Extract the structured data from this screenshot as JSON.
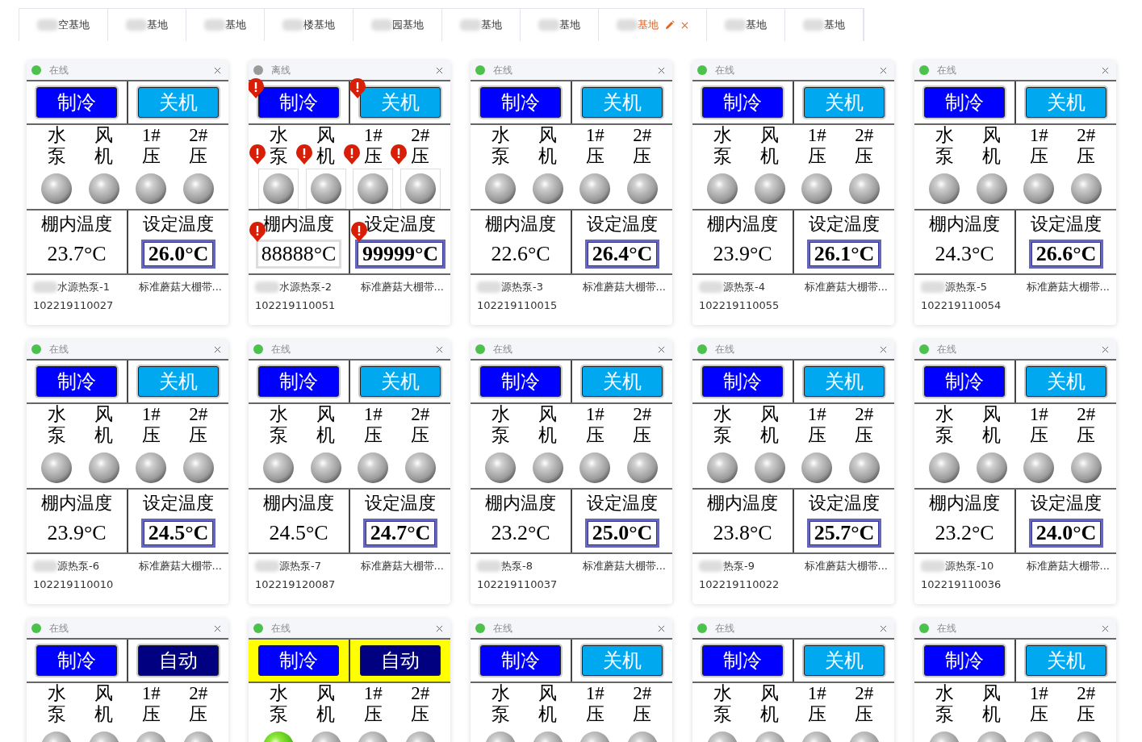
{
  "tabs": [
    {
      "label": "空基地",
      "selected": false
    },
    {
      "label": "基地",
      "selected": false
    },
    {
      "label": "基地",
      "selected": false
    },
    {
      "label": "楼基地",
      "selected": false
    },
    {
      "label": "园基地",
      "selected": false
    },
    {
      "label": "基地",
      "selected": false
    },
    {
      "label": "基地",
      "selected": false
    },
    {
      "label": "基地",
      "selected": true
    },
    {
      "label": "基地",
      "selected": false
    },
    {
      "label": "基地",
      "selected": false
    }
  ],
  "cards": [
    {
      "status": "在线",
      "online": true,
      "alarm": false,
      "highlight": false,
      "mode": "制冷",
      "power": {
        "label": "关机",
        "kind": "off"
      },
      "lamps": [
        {
          "top": "水",
          "bottom": "泵",
          "on": false
        },
        {
          "top": "风",
          "bottom": "机",
          "on": false
        },
        {
          "top": "1#",
          "bottom": "压",
          "on": false
        },
        {
          "top": "2#",
          "bottom": "压",
          "on": false
        }
      ],
      "inside_label": "棚内温度",
      "inside_temp": "23.7°C",
      "set_label": "设定温度",
      "set_temp": "26.0°C",
      "name": "水源热泵-1",
      "desc": "标准蘑菇大棚带...",
      "serial": "102219110027"
    },
    {
      "status": "离线",
      "online": false,
      "alarm": true,
      "highlight": false,
      "mode": "制冷",
      "power": {
        "label": "关机",
        "kind": "off"
      },
      "lamps": [
        {
          "top": "水",
          "bottom": "泵",
          "on": false
        },
        {
          "top": "风",
          "bottom": "机",
          "on": false
        },
        {
          "top": "1#",
          "bottom": "压",
          "on": false
        },
        {
          "top": "2#",
          "bottom": "压",
          "on": false
        }
      ],
      "inside_label": "棚内温度",
      "inside_temp": "88888°C",
      "set_label": "设定温度",
      "set_temp": "99999°C",
      "name": "水源热泵-2",
      "desc": "标准蘑菇大棚带...",
      "serial": "102219110051"
    },
    {
      "status": "在线",
      "online": true,
      "alarm": false,
      "highlight": false,
      "mode": "制冷",
      "power": {
        "label": "关机",
        "kind": "off"
      },
      "lamps": [
        {
          "top": "水",
          "bottom": "泵",
          "on": false
        },
        {
          "top": "风",
          "bottom": "机",
          "on": false
        },
        {
          "top": "1#",
          "bottom": "压",
          "on": false
        },
        {
          "top": "2#",
          "bottom": "压",
          "on": false
        }
      ],
      "inside_label": "棚内温度",
      "inside_temp": "22.6°C",
      "set_label": "设定温度",
      "set_temp": "26.4°C",
      "name": "源热泵-3",
      "desc": "标准蘑菇大棚带...",
      "serial": "102219110015"
    },
    {
      "status": "在线",
      "online": true,
      "alarm": false,
      "highlight": false,
      "mode": "制冷",
      "power": {
        "label": "关机",
        "kind": "off"
      },
      "lamps": [
        {
          "top": "水",
          "bottom": "泵",
          "on": false
        },
        {
          "top": "风",
          "bottom": "机",
          "on": false
        },
        {
          "top": "1#",
          "bottom": "压",
          "on": false
        },
        {
          "top": "2#",
          "bottom": "压",
          "on": false
        }
      ],
      "inside_label": "棚内温度",
      "inside_temp": "23.9°C",
      "set_label": "设定温度",
      "set_temp": "26.1°C",
      "name": "源热泵-4",
      "desc": "标准蘑菇大棚带...",
      "serial": "102219110055"
    },
    {
      "status": "在线",
      "online": true,
      "alarm": false,
      "highlight": false,
      "mode": "制冷",
      "power": {
        "label": "关机",
        "kind": "off"
      },
      "lamps": [
        {
          "top": "水",
          "bottom": "泵",
          "on": false
        },
        {
          "top": "风",
          "bottom": "机",
          "on": false
        },
        {
          "top": "1#",
          "bottom": "压",
          "on": false
        },
        {
          "top": "2#",
          "bottom": "压",
          "on": false
        }
      ],
      "inside_label": "棚内温度",
      "inside_temp": "24.3°C",
      "set_label": "设定温度",
      "set_temp": "26.6°C",
      "name": "源热泵-5",
      "desc": "标准蘑菇大棚带...",
      "serial": "102219110054"
    },
    {
      "status": "在线",
      "online": true,
      "alarm": false,
      "highlight": false,
      "mode": "制冷",
      "power": {
        "label": "关机",
        "kind": "off"
      },
      "lamps": [
        {
          "top": "水",
          "bottom": "泵",
          "on": false
        },
        {
          "top": "风",
          "bottom": "机",
          "on": false
        },
        {
          "top": "1#",
          "bottom": "压",
          "on": false
        },
        {
          "top": "2#",
          "bottom": "压",
          "on": false
        }
      ],
      "inside_label": "棚内温度",
      "inside_temp": "23.9°C",
      "set_label": "设定温度",
      "set_temp": "24.5°C",
      "name": "源热泵-6",
      "desc": "标准蘑菇大棚带...",
      "serial": "102219110010"
    },
    {
      "status": "在线",
      "online": true,
      "alarm": false,
      "highlight": false,
      "mode": "制冷",
      "power": {
        "label": "关机",
        "kind": "off"
      },
      "lamps": [
        {
          "top": "水",
          "bottom": "泵",
          "on": false
        },
        {
          "top": "风",
          "bottom": "机",
          "on": false
        },
        {
          "top": "1#",
          "bottom": "压",
          "on": false
        },
        {
          "top": "2#",
          "bottom": "压",
          "on": false
        }
      ],
      "inside_label": "棚内温度",
      "inside_temp": "24.5°C",
      "set_label": "设定温度",
      "set_temp": "24.7°C",
      "name": "源热泵-7",
      "desc": "标准蘑菇大棚带...",
      "serial": "102219120087"
    },
    {
      "status": "在线",
      "online": true,
      "alarm": false,
      "highlight": false,
      "mode": "制冷",
      "power": {
        "label": "关机",
        "kind": "off"
      },
      "lamps": [
        {
          "top": "水",
          "bottom": "泵",
          "on": false
        },
        {
          "top": "风",
          "bottom": "机",
          "on": false
        },
        {
          "top": "1#",
          "bottom": "压",
          "on": false
        },
        {
          "top": "2#",
          "bottom": "压",
          "on": false
        }
      ],
      "inside_label": "棚内温度",
      "inside_temp": "23.2°C",
      "set_label": "设定温度",
      "set_temp": "25.0°C",
      "name": "热泵-8",
      "desc": "标准蘑菇大棚带...",
      "serial": "102219110037"
    },
    {
      "status": "在线",
      "online": true,
      "alarm": false,
      "highlight": false,
      "mode": "制冷",
      "power": {
        "label": "关机",
        "kind": "off"
      },
      "lamps": [
        {
          "top": "水",
          "bottom": "泵",
          "on": false
        },
        {
          "top": "风",
          "bottom": "机",
          "on": false
        },
        {
          "top": "1#",
          "bottom": "压",
          "on": false
        },
        {
          "top": "2#",
          "bottom": "压",
          "on": false
        }
      ],
      "inside_label": "棚内温度",
      "inside_temp": "23.8°C",
      "set_label": "设定温度",
      "set_temp": "25.7°C",
      "name": "热泵-9",
      "desc": "标准蘑菇大棚带...",
      "serial": "102219110022"
    },
    {
      "status": "在线",
      "online": true,
      "alarm": false,
      "highlight": false,
      "mode": "制冷",
      "power": {
        "label": "关机",
        "kind": "off"
      },
      "lamps": [
        {
          "top": "水",
          "bottom": "泵",
          "on": false
        },
        {
          "top": "风",
          "bottom": "机",
          "on": false
        },
        {
          "top": "1#",
          "bottom": "压",
          "on": false
        },
        {
          "top": "2#",
          "bottom": "压",
          "on": false
        }
      ],
      "inside_label": "棚内温度",
      "inside_temp": "23.2°C",
      "set_label": "设定温度",
      "set_temp": "24.0°C",
      "name": "源热泵-10",
      "desc": "标准蘑菇大棚带...",
      "serial": "102219110036"
    },
    {
      "status": "在线",
      "online": true,
      "alarm": false,
      "highlight": false,
      "mode": "制冷",
      "power": {
        "label": "自动",
        "kind": "auto"
      },
      "lamps": [
        {
          "top": "水",
          "bottom": "泵",
          "on": false
        },
        {
          "top": "风",
          "bottom": "机",
          "on": false
        },
        {
          "top": "1#",
          "bottom": "压",
          "on": false
        },
        {
          "top": "2#",
          "bottom": "压",
          "on": false
        }
      ]
    },
    {
      "status": "在线",
      "online": true,
      "alarm": false,
      "highlight": true,
      "mode": "制冷",
      "power": {
        "label": "自动",
        "kind": "auto"
      },
      "lamps": [
        {
          "top": "水",
          "bottom": "泵",
          "on": true
        },
        {
          "top": "风",
          "bottom": "机",
          "on": false
        },
        {
          "top": "1#",
          "bottom": "压",
          "on": false
        },
        {
          "top": "2#",
          "bottom": "压",
          "on": false
        }
      ]
    },
    {
      "status": "在线",
      "online": true,
      "alarm": false,
      "highlight": false,
      "mode": "制冷",
      "power": {
        "label": "关机",
        "kind": "off"
      },
      "lamps": [
        {
          "top": "水",
          "bottom": "泵",
          "on": false
        },
        {
          "top": "风",
          "bottom": "机",
          "on": false
        },
        {
          "top": "1#",
          "bottom": "压",
          "on": false
        },
        {
          "top": "2#",
          "bottom": "压",
          "on": false
        }
      ]
    },
    {
      "status": "在线",
      "online": true,
      "alarm": false,
      "highlight": false,
      "mode": "制冷",
      "power": {
        "label": "关机",
        "kind": "off"
      },
      "lamps": [
        {
          "top": "水",
          "bottom": "泵",
          "on": false
        },
        {
          "top": "风",
          "bottom": "机",
          "on": false
        },
        {
          "top": "1#",
          "bottom": "压",
          "on": false
        },
        {
          "top": "2#",
          "bottom": "压",
          "on": false
        }
      ]
    },
    {
      "status": "在线",
      "online": true,
      "alarm": false,
      "highlight": false,
      "mode": "制冷",
      "power": {
        "label": "关机",
        "kind": "off"
      },
      "lamps": [
        {
          "top": "水",
          "bottom": "泵",
          "on": false
        },
        {
          "top": "风",
          "bottom": "机",
          "on": false
        },
        {
          "top": "1#",
          "bottom": "压",
          "on": false
        },
        {
          "top": "2#",
          "bottom": "压",
          "on": false
        }
      ]
    }
  ]
}
